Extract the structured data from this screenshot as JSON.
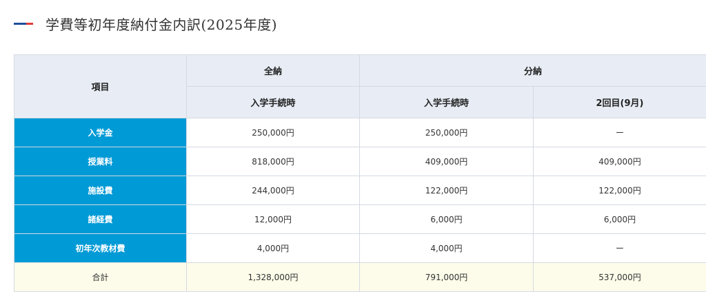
{
  "heading": {
    "title": "学費等初年度納付金内訳(2025年度)",
    "mark_colors": [
      "#1f4e9c",
      "#e23b3b"
    ]
  },
  "table": {
    "header": {
      "item": "項目",
      "lump": "全納",
      "installment": "分納",
      "lump_sub": "入学手続時",
      "installment_sub1": "入学手続時",
      "installment_sub2": "2回目(9月)"
    },
    "rows": [
      {
        "label": "入学金",
        "lump": "250,000円",
        "inst1": "250,000円",
        "inst2": "ー"
      },
      {
        "label": "授業料",
        "lump": "818,000円",
        "inst1": "409,000円",
        "inst2": "409,000円"
      },
      {
        "label": "施設費",
        "lump": "244,000円",
        "inst1": "122,000円",
        "inst2": "122,000円"
      },
      {
        "label": "諸経費",
        "lump": "12,000円",
        "inst1": "6,000円",
        "inst2": "6,000円"
      },
      {
        "label": "初年次教材費",
        "lump": "4,000円",
        "inst1": "4,000円",
        "inst2": "ー"
      }
    ],
    "total": {
      "label": "合計",
      "lump": "1,328,000円",
      "inst1": "791,000円",
      "inst2": "537,000円"
    },
    "colors": {
      "header_bg": "#e8edf5",
      "row_head_bg": "#009ad6",
      "total_bg": "#fdfcea",
      "border": "#d4d9e2"
    }
  }
}
